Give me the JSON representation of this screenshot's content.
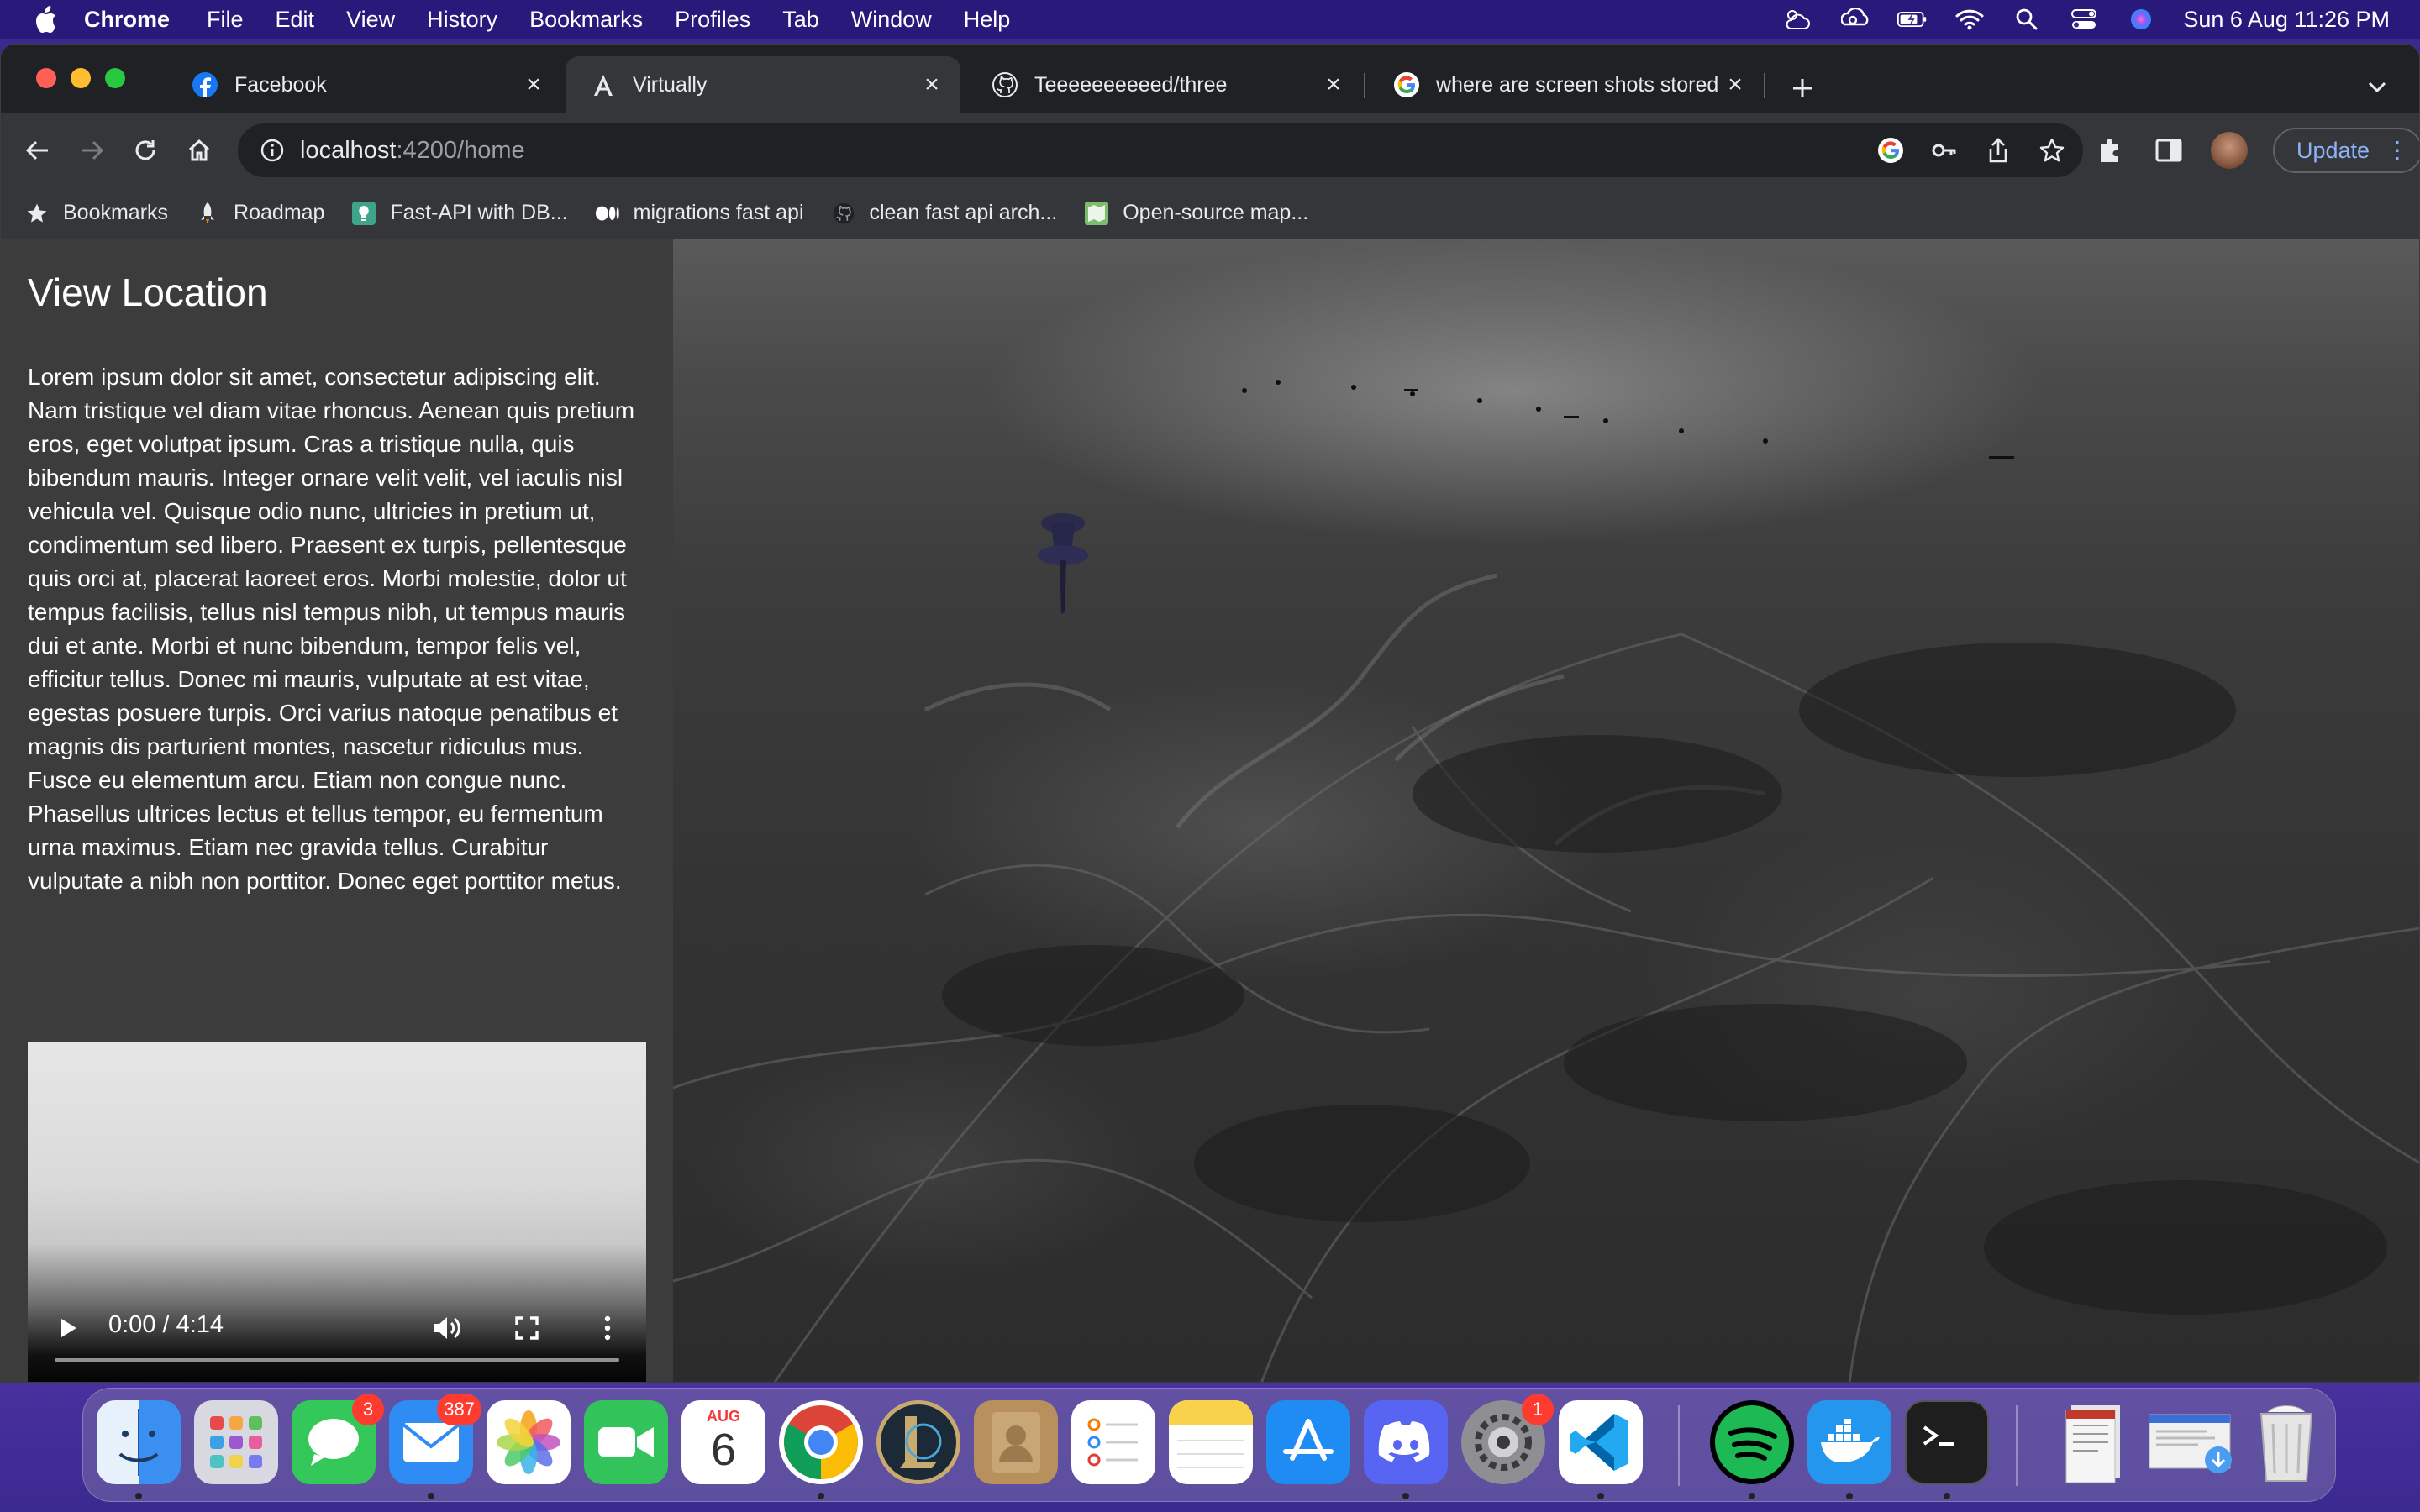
{
  "menubar": {
    "app_name": "Chrome",
    "items": [
      "File",
      "Edit",
      "View",
      "History",
      "Bookmarks",
      "Profiles",
      "Tab",
      "Window",
      "Help"
    ],
    "clock": "Sun 6 Aug  11:26 PM"
  },
  "tabs": [
    {
      "title": "Facebook",
      "icon": "facebook-icon",
      "active": false
    },
    {
      "title": "Virtually",
      "icon": "angular-icon",
      "active": true
    },
    {
      "title": "Teeeeeeeeeed/three",
      "icon": "github-icon",
      "active": false
    },
    {
      "title": "where are screen shots stored",
      "icon": "google-icon",
      "active": false
    }
  ],
  "omnibox": {
    "host": "localhost",
    "path": ":4200/home"
  },
  "toolbar": {
    "update_label": "Update"
  },
  "bookmarks": [
    {
      "label": "Bookmarks",
      "icon": "star-icon"
    },
    {
      "label": "Roadmap",
      "icon": "rocket-icon"
    },
    {
      "label": "Fast-API with DB...",
      "icon": "bulb-icon"
    },
    {
      "label": "migrations fast api",
      "icon": "medium-icon"
    },
    {
      "label": "clean fast api arch...",
      "icon": "github-icon"
    },
    {
      "label": "Open-source map...",
      "icon": "map-icon"
    }
  ],
  "page": {
    "title": "View Location",
    "description": "Lorem ipsum dolor sit amet, consectetur adipiscing elit. Nam tristique vel diam vitae rhoncus. Aenean quis pretium eros, eget volutpat ipsum. Cras a tristique nulla, quis bibendum mauris. Integer ornare velit velit, vel iaculis nisl vehicula vel. Quisque odio nunc, ultricies in pretium ut, condimentum sed libero. Praesent ex turpis, pellentesque quis orci at, placerat laoreet eros. Morbi molestie, dolor ut tempus facilisis, tellus nisl tempus nibh, ut tempus mauris dui et ante. Morbi et nunc bibendum, tempor felis vel, efficitur tellus. Donec mi mauris, vulputate at est vitae, egestas posuere turpis. Orci varius natoque penatibus et magnis dis parturient montes, nascetur ridiculus mus. Fusce eu elementum arcu. Etiam non congue nunc. Phasellus ultrices lectus et tellus tempor, eu fermentum urna maximus. Etiam nec gravida tellus. Curabitur vulputate a nibh non porttitor. Donec eget porttitor metus.",
    "video": {
      "time": "0:00 / 4:14",
      "progress": 0
    }
  },
  "dock": {
    "apps": [
      {
        "name": "Finder",
        "icon": "finder-icon",
        "color": "#3b8ff0",
        "running": true
      },
      {
        "name": "Launchpad",
        "icon": "launchpad-icon",
        "color": "#d8d8e0",
        "running": false
      },
      {
        "name": "Messages",
        "icon": "messages-icon",
        "color": "#34c759",
        "running": false,
        "badge": "3"
      },
      {
        "name": "Mail",
        "icon": "mail-icon",
        "color": "#2f8cf5",
        "running": true,
        "badge": "387"
      },
      {
        "name": "Photos",
        "icon": "photos-icon",
        "color": "#ffffff",
        "running": false
      },
      {
        "name": "FaceTime",
        "icon": "facetime-icon",
        "color": "#32c45a",
        "running": false
      },
      {
        "name": "Calendar",
        "icon": "calendar-icon",
        "color": "#ffffff",
        "running": false,
        "month": "AUG",
        "day": "6"
      },
      {
        "name": "Chrome",
        "icon": "chrome-icon",
        "color": "#ffffff",
        "running": true
      },
      {
        "name": "League of Legends",
        "icon": "league-icon",
        "color": "#1b2a36",
        "running": false
      },
      {
        "name": "Contacts",
        "icon": "contacts-icon",
        "color": "#b8905e",
        "running": false
      },
      {
        "name": "Reminders",
        "icon": "reminders-icon",
        "color": "#ffffff",
        "running": false
      },
      {
        "name": "Notes",
        "icon": "notes-icon",
        "color": "#f7d24a",
        "running": false
      },
      {
        "name": "App Store",
        "icon": "appstore-icon",
        "color": "#1f8cf4",
        "running": false
      },
      {
        "name": "Discord",
        "icon": "discord-icon",
        "color": "#5865f2",
        "running": true
      },
      {
        "name": "System Settings",
        "icon": "settings-icon",
        "color": "#8e8e93",
        "running": false,
        "badge": "1"
      },
      {
        "name": "VS Code",
        "icon": "vscode-icon",
        "color": "#ffffff",
        "running": true
      },
      {
        "name": "Spotify",
        "icon": "spotify-icon",
        "color": "#1db954",
        "running": true
      },
      {
        "name": "Docker",
        "icon": "docker-icon",
        "color": "#2496ed",
        "running": true
      },
      {
        "name": "Terminal",
        "icon": "terminal-icon",
        "color": "#1e1e1e",
        "running": true
      },
      {
        "name": "Documents",
        "icon": "documents-icon",
        "color": "#c9c9c9",
        "running": false
      },
      {
        "name": "Downloads",
        "icon": "downloads-icon",
        "color": "#a8c8f0",
        "running": false
      },
      {
        "name": "Trash",
        "icon": "trash-icon",
        "color": "#d0d0d0",
        "running": false
      }
    ]
  }
}
